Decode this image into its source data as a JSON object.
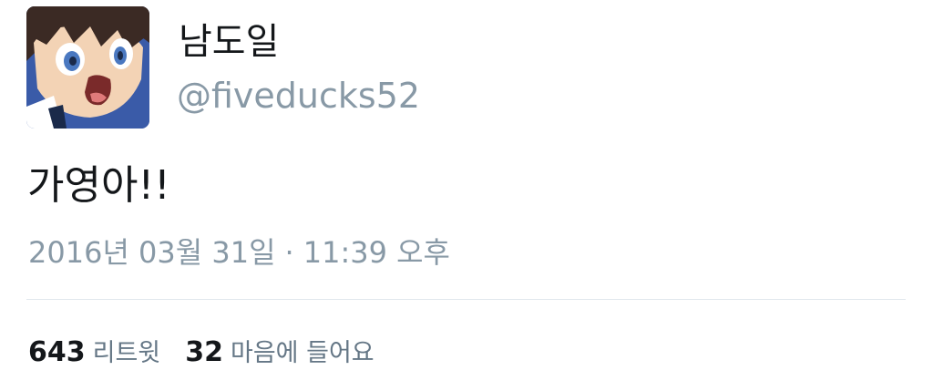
{
  "user": {
    "display_name": "남도일",
    "handle": "@fiveducks52"
  },
  "tweet": {
    "text": "가영아!!",
    "timestamp_date": "2016년 03월 31일",
    "timestamp_sep": "·",
    "timestamp_time": "11:39 오후"
  },
  "stats": {
    "retweets_count": "643",
    "retweets_label": "리트윗",
    "likes_count": "32",
    "likes_label": "마음에 들어요"
  },
  "colors": {
    "primary_text": "#14171a",
    "secondary_text": "#8899a6",
    "divider": "#e1e8ed"
  }
}
